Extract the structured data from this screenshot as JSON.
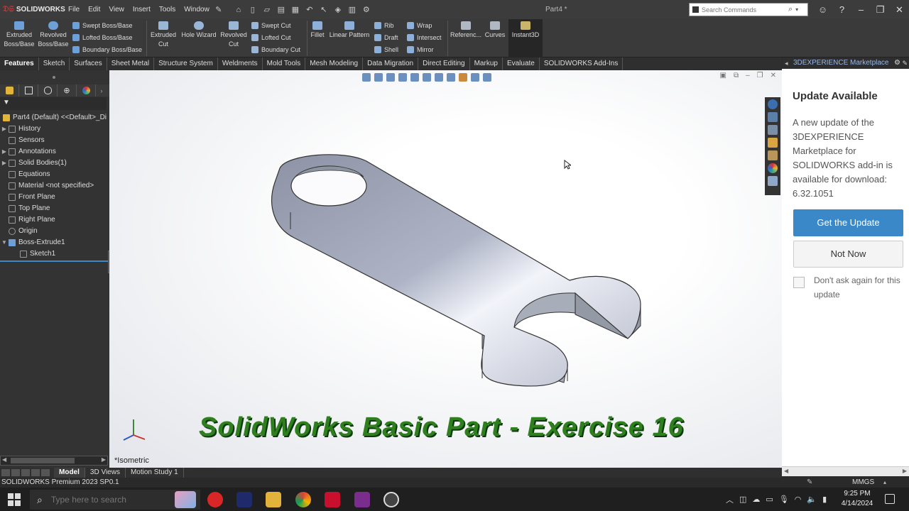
{
  "app": {
    "brand": "SOLIDWORKS",
    "document_title": "Part4 *"
  },
  "menu": [
    "File",
    "Edit",
    "View",
    "Insert",
    "Tools",
    "Window"
  ],
  "search": {
    "placeholder": "Search Commands"
  },
  "ribbon": {
    "extruded_boss": "Extruded Boss/Base",
    "revolved_boss": "Revolved Boss/Base",
    "swept_boss": "Swept Boss/Base",
    "lofted_boss": "Lofted Boss/Base",
    "boundary_boss": "Boundary Boss/Base",
    "extruded_cut": "Extruded Cut",
    "hole_wizard": "Hole Wizard",
    "revolved_cut": "Revolved Cut",
    "swept_cut": "Swept Cut",
    "lofted_cut": "Lofted Cut",
    "boundary_cut": "Boundary Cut",
    "fillet": "Fillet",
    "linear_pattern": "Linear Pattern",
    "rib": "Rib",
    "draft": "Draft",
    "shell": "Shell",
    "wrap": "Wrap",
    "intersect": "Intersect",
    "mirror": "Mirror",
    "reference": "Referenc...",
    "curves": "Curves",
    "instant3d": "Instant3D"
  },
  "cm_tabs": [
    "Features",
    "Sketch",
    "Surfaces",
    "Sheet Metal",
    "Structure System",
    "Weldments",
    "Mold Tools",
    "Mesh Modeling",
    "Data Migration",
    "Direct Editing",
    "Markup",
    "Evaluate",
    "SOLIDWORKS Add-Ins"
  ],
  "tree": {
    "root": "Part4 (Default) <<Default>_Di",
    "items": [
      {
        "label": "History",
        "expandable": true
      },
      {
        "label": "Sensors",
        "expandable": false
      },
      {
        "label": "Annotations",
        "expandable": true
      },
      {
        "label": "Solid Bodies(1)",
        "expandable": true
      },
      {
        "label": "Equations",
        "expandable": false
      },
      {
        "label": "Material <not specified>",
        "expandable": false
      },
      {
        "label": "Front Plane",
        "expandable": false
      },
      {
        "label": "Top Plane",
        "expandable": false
      },
      {
        "label": "Right Plane",
        "expandable": false
      },
      {
        "label": "Origin",
        "expandable": false
      },
      {
        "label": "Boss-Extrude1",
        "expandable": true
      },
      {
        "label": "Sketch1",
        "expandable": false
      }
    ]
  },
  "viewport": {
    "overlay_title": "SolidWorks Basic Part - Exercise 16",
    "view_label": "*Isometric"
  },
  "task_pane": {
    "header": "3DEXPERIENCE Marketplace",
    "title": "Update Available",
    "message": "A new update of the 3DEXPERIENCE Marketplace for SOLIDWORKS add-in is available for download: 6.32.1051",
    "primary_button": "Get the Update",
    "secondary_button": "Not Now",
    "checkbox_label": "Don't ask again for this update"
  },
  "bottom_tabs": [
    "Model",
    "3D Views",
    "Motion Study 1"
  ],
  "status": {
    "product": "SOLIDWORKS Premium 2023 SP0.1",
    "units": "MMGS"
  },
  "taskbar": {
    "search_placeholder": "Type here to search",
    "time": "9:25 PM",
    "date": "4/14/2024"
  },
  "colors": {
    "accent": "#3b88c9",
    "overlay_text": "#2f7f1e",
    "background": "#3a3a3a"
  }
}
